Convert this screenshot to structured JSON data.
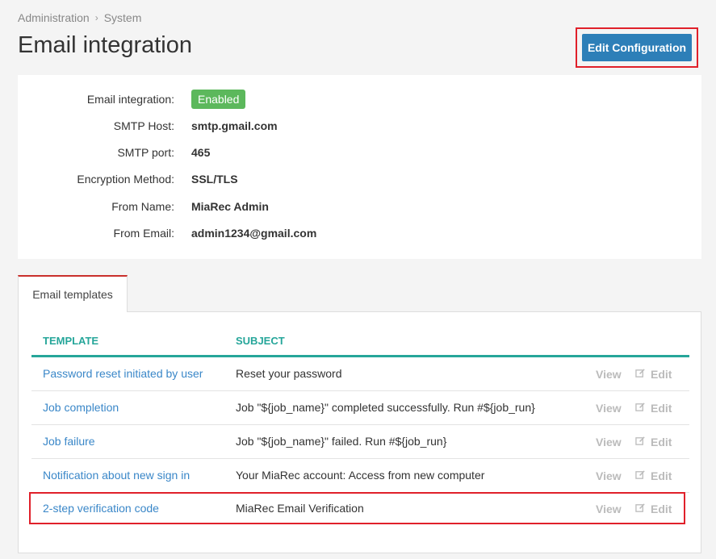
{
  "breadcrumb": {
    "items": [
      "Administration",
      "System"
    ],
    "separator": "›"
  },
  "page": {
    "title": "Email integration"
  },
  "toolbar": {
    "edit_config_label": "Edit Configuration"
  },
  "settings": {
    "email_integration": {
      "label": "Email integration:",
      "value": "Enabled"
    },
    "smtp_host": {
      "label": "SMTP Host:",
      "value": "smtp.gmail.com"
    },
    "smtp_port": {
      "label": "SMTP port:",
      "value": "465"
    },
    "encryption": {
      "label": "Encryption Method:",
      "value": "SSL/TLS"
    },
    "from_name": {
      "label": "From Name:",
      "value": "MiaRec Admin"
    },
    "from_email": {
      "label": "From Email:",
      "value": "admin1234@gmail.com"
    }
  },
  "tabs": [
    {
      "label": "Email templates",
      "active": true
    }
  ],
  "templates": {
    "columns": {
      "template": "TEMPLATE",
      "subject": "SUBJECT"
    },
    "actions": {
      "view": "View",
      "edit": "Edit"
    },
    "rows": [
      {
        "name": "Password reset initiated by user",
        "subject": "Reset your password"
      },
      {
        "name": "Job completion",
        "subject": "Job \"${job_name}\" completed successfully. Run #${job_run}"
      },
      {
        "name": "Job failure",
        "subject": "Job \"${job_name}\" failed. Run #${job_run}"
      },
      {
        "name": "Notification about new sign in",
        "subject": "Your MiaRec account: Access from new computer"
      },
      {
        "name": "2-step verification code",
        "subject": "MiaRec Email Verification"
      }
    ]
  },
  "icons": {
    "chevron": "chevron-right-icon",
    "edit": "pencil-square-icon"
  },
  "colors": {
    "primary_button": "#2d7fb8",
    "enabled_badge": "#5cb85c",
    "table_accent": "#26a69a",
    "link": "#3a87c8",
    "highlight": "#e0202a",
    "tab_accent": "#c9302c"
  }
}
